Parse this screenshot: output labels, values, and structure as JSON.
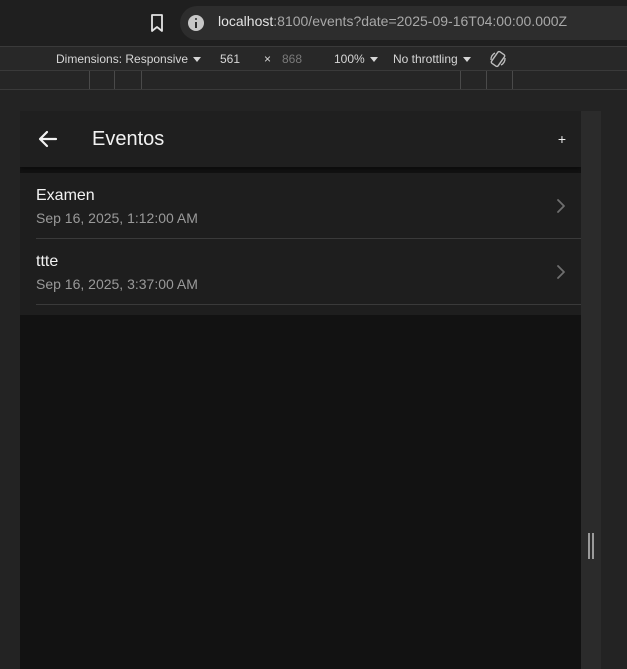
{
  "browser": {
    "url_host": "localhost",
    "url_rest": ":8100/events?date=2025-09-16T04:00:00.000Z"
  },
  "device_toolbar": {
    "dimensions_label": "Dimensions: Responsive",
    "width": "561",
    "times": "×",
    "height": "868",
    "zoom": "100%",
    "throttling": "No throttling"
  },
  "app": {
    "title": "Eventos",
    "add_label": "+",
    "events": [
      {
        "title": "Examen",
        "date": "Sep 16, 2025, 1:12:00 AM"
      },
      {
        "title": "ttte",
        "date": "Sep 16, 2025, 3:37:00 AM"
      }
    ]
  },
  "icons": {
    "bookmark": "bookmark-icon",
    "info": "info-icon",
    "rotate": "rotate-icon",
    "back": "arrow-left-icon",
    "chevron": "chevron-right-icon"
  },
  "colors": {
    "app_background": "#121212",
    "header_background": "#1f1f1f",
    "list_background": "#1e1e1e",
    "text_primary": "#f2f2f2",
    "text_secondary": "#9a9a9a"
  }
}
